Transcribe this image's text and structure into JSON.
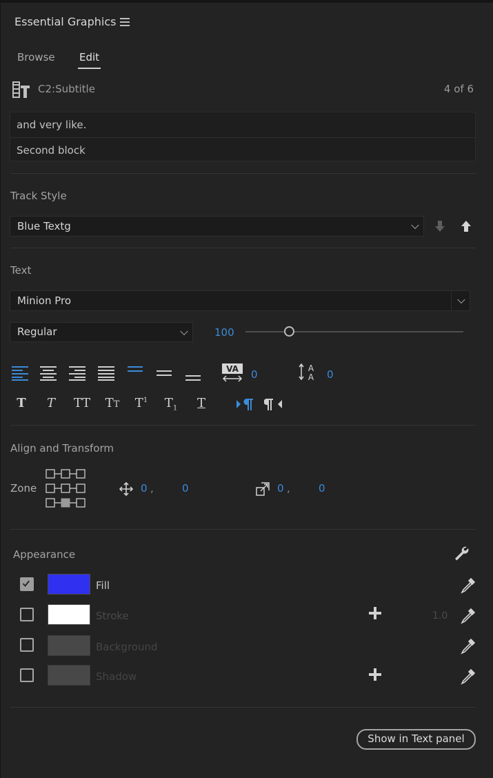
{
  "panel": {
    "title": "Essential Graphics",
    "menu_icon": "hamburger-icon"
  },
  "tabs": {
    "browse": "Browse",
    "edit": "Edit"
  },
  "clip": {
    "icon": "clip-text-icon",
    "name": "C2:Subtitle",
    "count": "4 of 6"
  },
  "text_blocks": [
    "and very like.",
    "Second block"
  ],
  "track_style": {
    "heading": "Track Style",
    "value": "Blue Textg",
    "push_down_icon": "arrow-down-icon",
    "push_up_icon": "arrow-up-icon"
  },
  "text": {
    "heading": "Text",
    "font": "Minion Pro",
    "style": "Regular",
    "size": "100",
    "size_fraction": 0.2,
    "tracking": "0",
    "leading": "0",
    "accent_color": "#3b8bd9"
  },
  "align_transform": {
    "heading": "Align and Transform",
    "zone_label": "Zone",
    "position_x": "0",
    "position_sep": ",",
    "position_y": "0",
    "scale_x": "0",
    "scale_sep": ",",
    "scale_y": "0"
  },
  "appearance": {
    "heading": "Appearance",
    "rows": [
      {
        "label": "Fill",
        "checked": true,
        "color": "#3030f0"
      },
      {
        "label": "Stroke",
        "checked": false,
        "color": "#ffffff",
        "value": "1.0"
      },
      {
        "label": "Background",
        "checked": false,
        "color": "#484848"
      },
      {
        "label": "Shadow",
        "checked": false,
        "color": "#484848"
      }
    ]
  },
  "footer": {
    "show_in_text_panel": "Show in Text panel"
  }
}
